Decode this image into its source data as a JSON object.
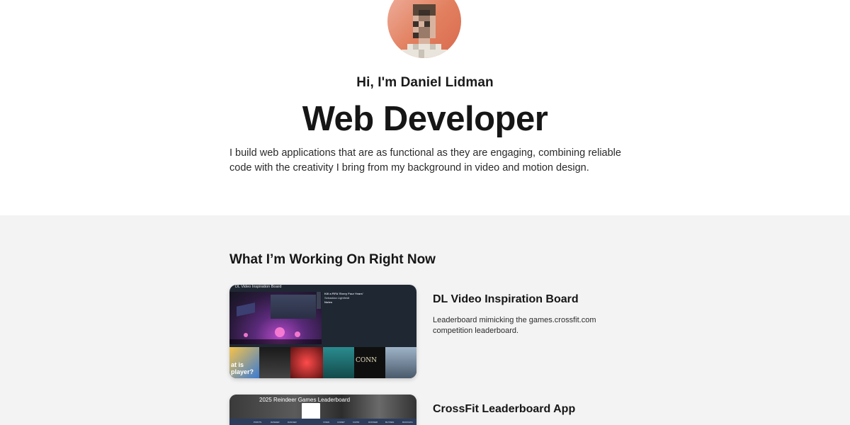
{
  "hero": {
    "greeting": "Hi, I'm Daniel Lidman",
    "headline": "Web Developer",
    "intro": "I build web applications that are as functional as they are engaging, combining reliable code with the creativity I bring from my background in video and motion design."
  },
  "work": {
    "section_title": "What I’m Working On Right Now",
    "projects": [
      {
        "title": "DL Video Inspiration Board",
        "description": "Leaderboard mimicking the games.crossfit.com competition leaderboard.",
        "thumb": {
          "label": "DL Video Inspiration Board",
          "info_lines": [
            "Kill a FIFA 'Every Four Years'",
            "Sebastian Lightfeldt",
            "",
            "",
            "Notes",
            "",
            ""
          ],
          "tiles": [
            {
              "text": "at is\nplayer?",
              "color": "#f2b03a"
            },
            {
              "text": "",
              "color": "#222"
            },
            {
              "text": "",
              "color": "#7a1e1e"
            },
            {
              "text": "",
              "color": "#1f6b6d"
            },
            {
              "text": "CONN",
              "color": "#111"
            },
            {
              "text": "",
              "color": "#6e7f95"
            }
          ]
        }
      },
      {
        "title": "CrossFit Leaderboard App",
        "description": "",
        "thumb": {
          "label": "2025 Reindeer Games Leaderboard",
          "nav_items": [
            "POINTS",
            "DASHER",
            "DANCER",
            "",
            "VIXEN",
            "COMET",
            "CUPID",
            "DONNER",
            "BLITZEN",
            "RUDOLPH"
          ]
        }
      }
    ]
  },
  "colors": {
    "hero_bg": "#ffffff",
    "section_bg": "#f3f3f3",
    "text": "#161616",
    "avatar_bg": "#e2805f"
  }
}
